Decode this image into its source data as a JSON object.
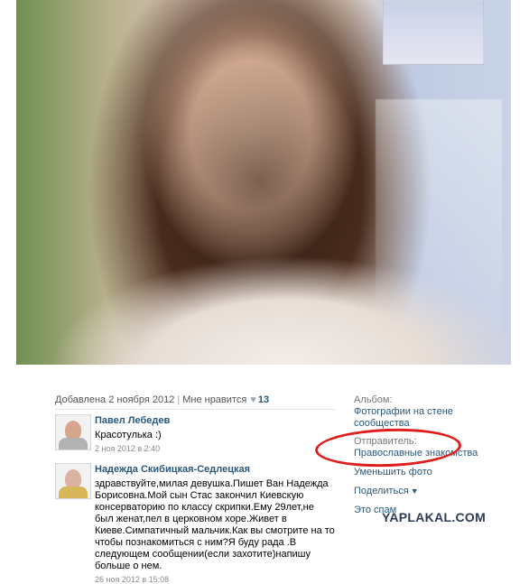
{
  "photo": {
    "alt": "photo"
  },
  "post": {
    "added_label": "Добавлена 2 ноября 2012",
    "like_label": "Мне нравится",
    "like_icon": "heart-icon",
    "likes": "13"
  },
  "comments": [
    {
      "name": "Павел Лебедев",
      "text": "Красотулька :)",
      "date": "2 ноя 2012 в 2:40"
    },
    {
      "name": "Надежда Скибицкая-Седлецкая",
      "text": "здравствуйте,милая девушка.Пишет Ван Надежда Борисовна.Мой сын Стас закончил Киевскую консерваторию по классу скрипки.Ему 29лет,не был женат,пел в церковном хоре.Живет в Киеве.Симпатичный мальчик.Как вы смотрите на то чтобы познакомиться с ним?Я буду рада .В следующем сообщении(если захотите)напишу больше о нем.",
      "date": "26 ноя 2012 в 15:08"
    }
  ],
  "sidebar": {
    "album_label": "Альбом:",
    "album_link": "Фотографии на стене сообщества",
    "sender_label": "Отправитель:",
    "sender_link": "Православные знакомства",
    "partial_line": "Уменьшить фото",
    "share_label": "Поделиться",
    "spam_label": "Это спам"
  },
  "watermark": "YAPLAKAL.COM",
  "colors": {
    "link": "#2b587a",
    "red_mark": "#e11c1c",
    "muted": "#8b8b8b"
  }
}
